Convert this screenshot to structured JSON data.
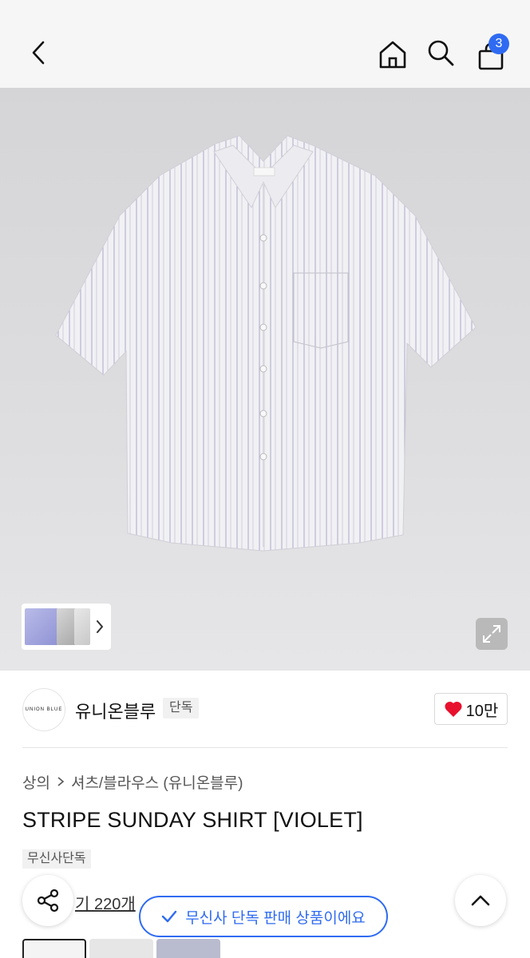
{
  "header": {
    "cart_count": "3"
  },
  "product": {
    "brand_logo_text": "UNION BLUE",
    "brand_name": "유니온블루",
    "brand_tag": "단독",
    "likes": "10만",
    "breadcrumb": [
      "상의",
      "셔츠/블라우스 (유니온블루)"
    ],
    "title": "STRIPE SUNDAY SHIRT [VIOLET]",
    "exclusive_badge": "무신사단독",
    "reviews": "기 220개",
    "colors": {
      "hero_bg": "#dcdcde",
      "accent": "#2f6bf2",
      "heart": "#e8112d"
    }
  },
  "toast": {
    "text": "무신사 단독 판매 상품이에요"
  }
}
